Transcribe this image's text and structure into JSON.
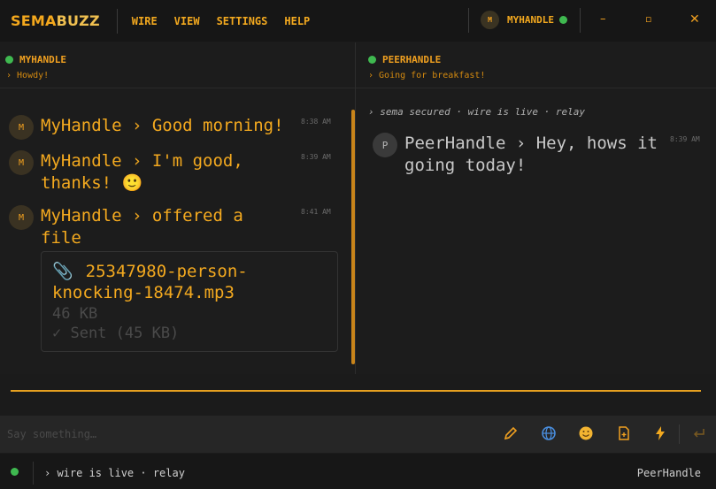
{
  "app": {
    "logo_part1": "SEMA",
    "logo_part2": "BUZZ"
  },
  "menu": [
    "WIRE",
    "VIEW",
    "SETTINGS",
    "HELP"
  ],
  "user": {
    "avatar_initial": "M",
    "name": "MYHANDLE"
  },
  "window": {
    "minimize": "–",
    "maximize": "▫",
    "close": "✕"
  },
  "left_pane": {
    "name": "MYHANDLE",
    "status": "› Howdy!",
    "messages": [
      {
        "initial": "M",
        "text": "MyHandle › Good morning!",
        "time": "8:38 AM"
      },
      {
        "initial": "M",
        "text": "MyHandle › I'm good, thanks! 🙂",
        "time": "8:39 AM"
      },
      {
        "initial": "M",
        "text": "MyHandle › offered a file",
        "time": "8:41 AM"
      }
    ],
    "file": {
      "icon": "📎",
      "name": "25347980-person-knocking-18474.mp3",
      "size": "46 KB",
      "status": "✓ Sent (45 KB)"
    }
  },
  "right_pane": {
    "name": "PEERHANDLE",
    "status": "› Going for breakfast!",
    "system_line": "› sema secured · wire is live · relay",
    "messages": [
      {
        "initial": "P",
        "text": "PeerHandle › Hey, hows it going today!",
        "time": "8:39 AM"
      }
    ]
  },
  "composer": {
    "placeholder": "Say something…"
  },
  "toolbar": {
    "edit_icon": "pencil-icon",
    "globe_icon": "globe-icon",
    "emoji_icon": "emoji-icon",
    "file_icon": "file-icon",
    "bolt_icon": "bolt-icon",
    "send_icon": "send-icon"
  },
  "status_bar": {
    "text": "› wire is live · relay",
    "peer": "PeerHandle"
  },
  "colors": {
    "accent": "#f3a91f",
    "online": "#3fb950",
    "bg": "#1b1b1b"
  }
}
